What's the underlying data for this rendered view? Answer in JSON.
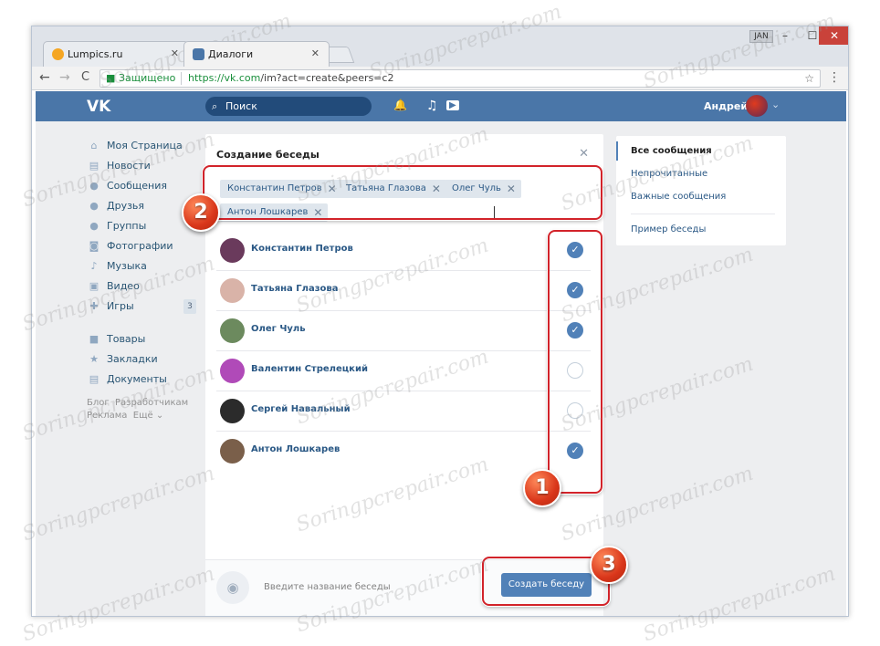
{
  "browser": {
    "tabs": [
      {
        "label": "Lumpics.ru",
        "favicon_color": "#f5a623"
      },
      {
        "label": "Диалоги",
        "favicon_color": "#4a76a8"
      }
    ],
    "profile": "JAN",
    "win_min": "–",
    "win_max": "☐",
    "win_close": "✕",
    "tab_close": "✕",
    "nav_back": "←",
    "nav_forward": "→",
    "nav_reload": "C",
    "secure_label": "Защищено",
    "url_scheme": "https://",
    "url_host": "vk.com",
    "url_rest": "/im?act=create&peers=c2",
    "star": "☆",
    "menu": "⋮"
  },
  "vk_header": {
    "logo": "VK",
    "search_placeholder": "Поиск",
    "search_icon": "⌕",
    "bell_icon": "🔔",
    "music_icon": "♫",
    "play_icon": "▶",
    "user_name": "Андрей",
    "caret": "⌄"
  },
  "left_nav": {
    "items": [
      {
        "label": "Моя Страница",
        "icon": "home-icon",
        "glyph": "⌂"
      },
      {
        "label": "Новости",
        "icon": "news-icon",
        "glyph": "▤"
      },
      {
        "label": "Сообщения",
        "icon": "messages-icon",
        "glyph": "●"
      },
      {
        "label": "Друзья",
        "icon": "friends-icon",
        "glyph": "●"
      },
      {
        "label": "Группы",
        "icon": "groups-icon",
        "glyph": "●"
      },
      {
        "label": "Фотографии",
        "icon": "camera-icon",
        "glyph": "◙"
      },
      {
        "label": "Музыка",
        "icon": "music-icon",
        "glyph": "♪"
      },
      {
        "label": "Видео",
        "icon": "video-icon",
        "glyph": "▣"
      },
      {
        "label": "Игры",
        "icon": "games-icon",
        "glyph": "✚",
        "count": "3"
      },
      {
        "label": "Товары",
        "icon": "bag-icon",
        "glyph": "■"
      },
      {
        "label": "Закладки",
        "icon": "star-icon",
        "glyph": "★"
      },
      {
        "label": "Документы",
        "icon": "document-icon",
        "glyph": "▤"
      }
    ],
    "footer_line1_a": "Блог",
    "footer_line1_b": "Разработчикам",
    "footer_line2_a": "Реклама",
    "footer_line2_b": "Ещё ⌄"
  },
  "panel": {
    "title": "Создание беседы",
    "close": "✕",
    "chips": [
      {
        "label": "Константин Петров"
      },
      {
        "label": "Татьяна Глазова"
      },
      {
        "label": "Олег Чуль"
      },
      {
        "label": "Антон Лошкарев"
      }
    ],
    "chip_x": "✕",
    "contacts": [
      {
        "name": "Константин Петров",
        "checked": true,
        "avatar_color": "#6a3a5c"
      },
      {
        "name": "Татьяна Глазова",
        "checked": true,
        "avatar_color": "#d9b3a8"
      },
      {
        "name": "Олег Чуль",
        "checked": true,
        "avatar_color": "#6c8a5e"
      },
      {
        "name": "Валентин Стрелецкий",
        "checked": false,
        "avatar_color": "#b04ab8"
      },
      {
        "name": "Сергей Навальный",
        "checked": false,
        "avatar_color": "#2b2b2b"
      },
      {
        "name": "Антон Лошкарев",
        "checked": true,
        "avatar_color": "#7a5f4a"
      }
    ],
    "checkmark": "✓",
    "camera_icon": "◉",
    "chat_name_placeholder": "Введите название беседы",
    "create_button": "Создать беседу"
  },
  "right_nav": {
    "items": [
      "Все сообщения",
      "Непрочитанные",
      "Важные сообщения"
    ],
    "example": "Пример беседы"
  },
  "annotations": {
    "badge_1": "1",
    "badge_2": "2",
    "badge_3": "3",
    "color": "#d2232a"
  },
  "watermark": "Soringpcrepair.com"
}
